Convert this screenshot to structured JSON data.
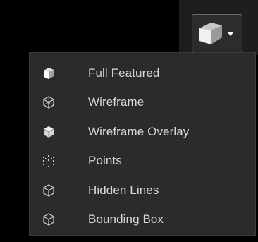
{
  "toolbar": {
    "render_mode_button_icon": "solid-cube-icon",
    "dropdown_arrow_icon": "caret-down-icon"
  },
  "menu": {
    "items": [
      {
        "label": "Full Featured",
        "icon": "solid-cube-icon"
      },
      {
        "label": "Wireframe",
        "icon": "wireframe-cube-icon"
      },
      {
        "label": "Wireframe Overlay",
        "icon": "wireframe-overlay-cube-icon"
      },
      {
        "label": "Points",
        "icon": "points-cube-icon"
      },
      {
        "label": "Hidden Lines",
        "icon": "hidden-lines-cube-icon"
      },
      {
        "label": "Bounding Box",
        "icon": "bounding-box-icon"
      }
    ]
  },
  "colors": {
    "background": "#000000",
    "menu_background": "#2b2b2b",
    "text": "#d8d8d8",
    "button_border": "#6a6a6a"
  }
}
